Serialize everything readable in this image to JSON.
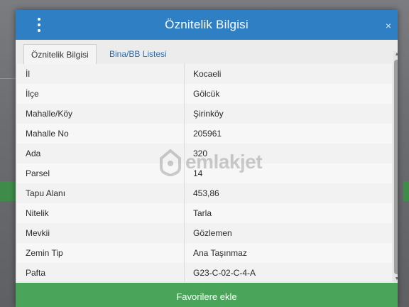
{
  "dialog": {
    "title": "Öznitelik Bilgisi",
    "header_color": "#2e7fc4",
    "close_glyph": "×"
  },
  "tabs": [
    {
      "label": "Öznitelik Bilgisi",
      "active": true
    },
    {
      "label": "Bina/BB Listesi",
      "active": false
    }
  ],
  "rows": [
    {
      "label": "İl",
      "value": "Kocaeli"
    },
    {
      "label": "İlçe",
      "value": "Gölcük"
    },
    {
      "label": "Mahalle/Köy",
      "value": "Şirinköy"
    },
    {
      "label": "Mahalle No",
      "value": "205961"
    },
    {
      "label": "Ada",
      "value": "320"
    },
    {
      "label": "Parsel",
      "value": "14"
    },
    {
      "label": "Tapu Alanı",
      "value": "453,86"
    },
    {
      "label": "Nitelik",
      "value": "Tarla"
    },
    {
      "label": "Mevkii",
      "value": "Gözlemen"
    },
    {
      "label": "Zemin Tip",
      "value": "Ana Taşınmaz"
    },
    {
      "label": "Pafta",
      "value": "G23-C-02-C-4-A"
    }
  ],
  "footer": {
    "favorite_label": "Favorilere ekle",
    "button_color": "#4aa55a"
  },
  "watermark": {
    "text": "emlakjet",
    "icon": "house-pin-icon"
  },
  "icons": {
    "menu": "vertical-dots-icon",
    "close": "close-icon",
    "scroll_up": "arrow-up-icon",
    "scroll_down": "arrow-down-icon"
  }
}
